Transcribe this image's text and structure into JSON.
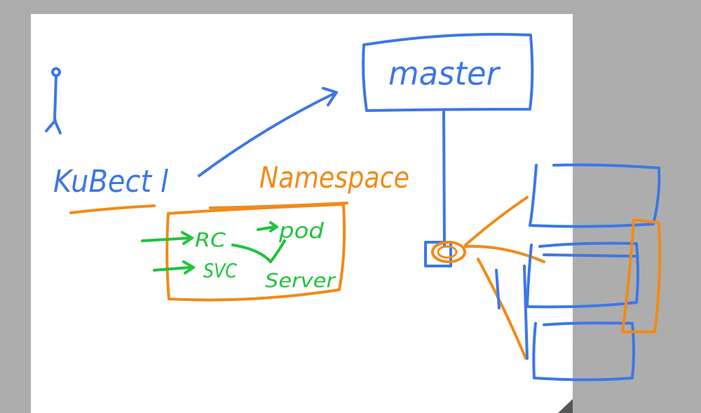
{
  "labels": {
    "master": "master",
    "kubectl": "KuBect l",
    "namespace": "Namespace",
    "rc": "RC",
    "pod": "pod",
    "svc": "SVC",
    "server": "Server"
  },
  "colors": {
    "outer_background": "#adadad",
    "whiteboard": "#ffffff",
    "blue_ink": "#3d77e6",
    "orange_ink": "#f28a17",
    "green_ink": "#1fc43a"
  }
}
